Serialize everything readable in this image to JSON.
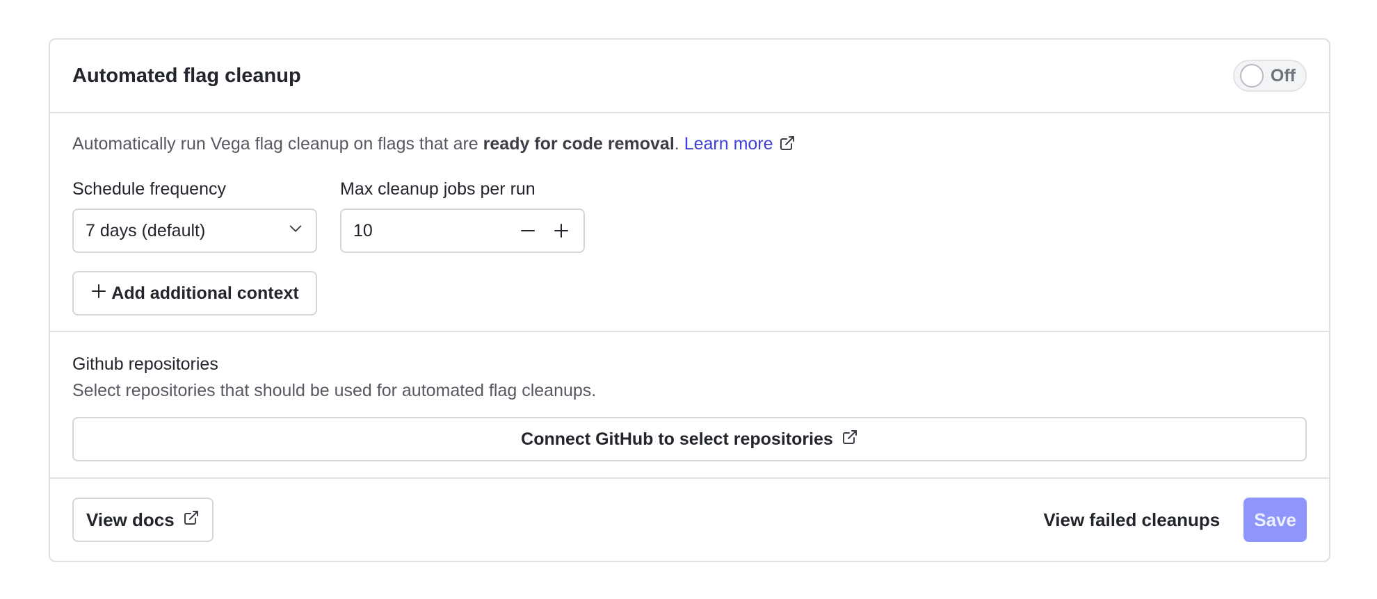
{
  "card": {
    "title": "Automated flag cleanup",
    "toggle_label": "Off"
  },
  "description": {
    "prefix": "Automatically run Vega flag cleanup on flags that are ",
    "bold": "ready for code removal",
    "suffix": ". ",
    "link": "Learn more"
  },
  "schedule": {
    "label": "Schedule frequency",
    "value": "7 days (default)"
  },
  "max_jobs": {
    "label": "Max cleanup jobs per run",
    "value": "10"
  },
  "add_context": {
    "label": "Add additional context"
  },
  "github": {
    "title": "Github repositories",
    "description": "Select repositories that should be used for automated flag cleanups.",
    "connect_label": "Connect GitHub to select repositories"
  },
  "footer": {
    "docs_label": "View docs",
    "failed_label": "View failed cleanups",
    "save_label": "Save"
  },
  "colors": {
    "link": "#3b3fd6",
    "save_bg": "#8e96fb",
    "border": "#dfe0e4"
  },
  "icons": [
    "external-link-icon",
    "chevron-down-icon",
    "minus-icon",
    "plus-icon",
    "toggle-knob"
  ]
}
